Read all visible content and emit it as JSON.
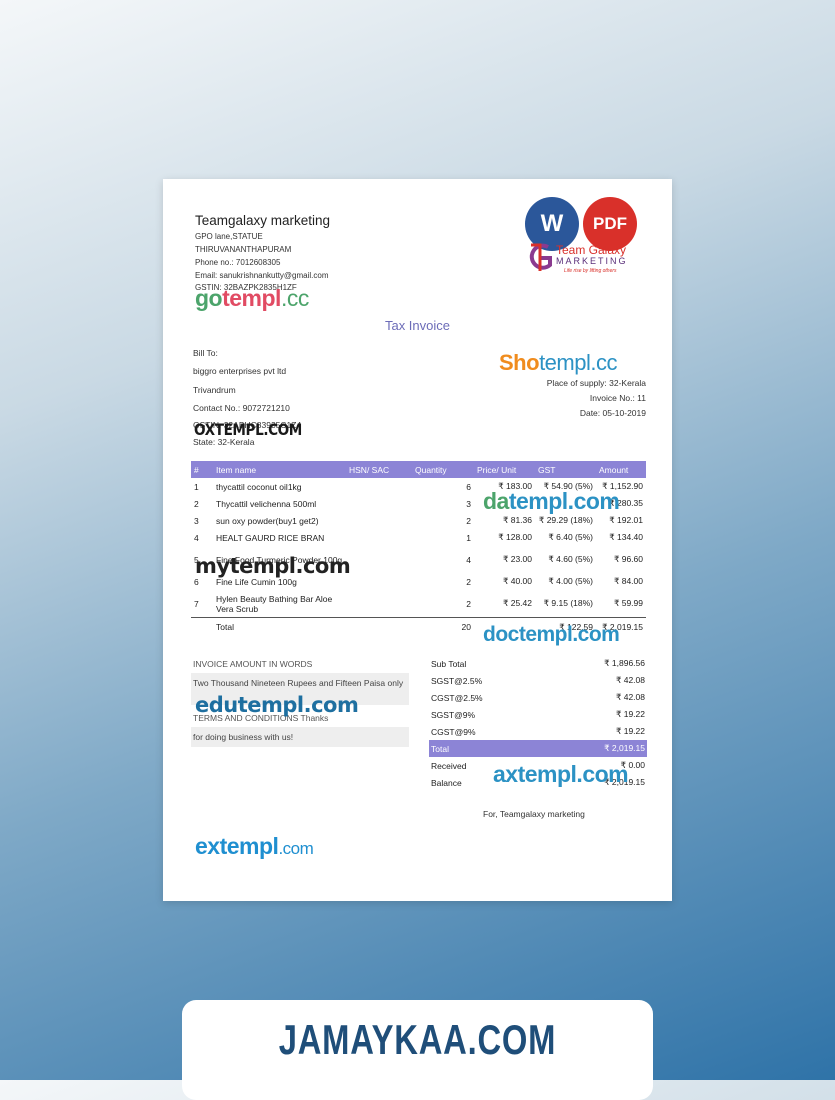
{
  "company": {
    "name": "Teamgalaxy marketing",
    "lines": [
      "GPO lane,STATUE",
      "THIRUVANANTHAPURAM",
      "Phone no.: 7012608305",
      "Email: sanukrishnankutty@gmail.com",
      "GSTIN: 32BAZPK2835H1ZF"
    ]
  },
  "badges": {
    "word": "W",
    "pdf": "PDF"
  },
  "logo": {
    "line1": "Team Galaxy",
    "line2": "MARKETING",
    "tagline": "Life rise by lifting others"
  },
  "doc_title": "Tax Invoice",
  "bill_to": {
    "label": "Bill To:",
    "name": "biggro enterprises pvt ltd",
    "city": "Trivandrum",
    "contact": "Contact No.: 9072721210",
    "gstin": "GSTIN: 32ABHC83935C1Z4",
    "state": "State: 32-Kerala"
  },
  "meta": {
    "place": "Place of supply: 32-Kerala",
    "invoice_no": "Invoice No.: 11",
    "date": "Date: 05-10-2019"
  },
  "table": {
    "headers": [
      "#",
      "Item name",
      "HSN/ SAC",
      "Quantity",
      "Price/ Unit",
      "GST",
      "Amount"
    ],
    "rows": [
      {
        "n": "1",
        "item": "thycattil coconut oil1kg",
        "hsn": "",
        "qty": "6",
        "price": "₹ 183.00",
        "gst": "₹ 54.90 (5%)",
        "amount": "₹ 1,152.90"
      },
      {
        "n": "2",
        "item": "Thycattil velichenna 500ml",
        "hsn": "",
        "qty": "3",
        "price": "",
        "gst": "",
        "amount": "₹ 280.35"
      },
      {
        "n": "3",
        "item": "sun oxy powder(buy1 get2)",
        "hsn": "",
        "qty": "2",
        "price": "₹ 81.36",
        "gst": "₹ 29.29 (18%)",
        "amount": "₹ 192.01"
      },
      {
        "n": "4",
        "item": "HEALT GAURD RICE BRAN",
        "hsn": "",
        "qty": "1",
        "price": "₹ 128.00",
        "gst": "₹ 6.40 (5%)",
        "amount": "₹ 134.40"
      },
      {
        "n": "5",
        "item": "Fine Food Turmeric Powder 100g",
        "hsn": "",
        "qty": "4",
        "price": "₹ 23.00",
        "gst": "₹ 4.60 (5%)",
        "amount": "₹ 96.60"
      },
      {
        "n": "6",
        "item": "Fine Life Cumin 100g",
        "hsn": "",
        "qty": "2",
        "price": "₹ 40.00",
        "gst": "₹ 4.00 (5%)",
        "amount": "₹ 84.00"
      },
      {
        "n": "7",
        "item": "Hylen Beauty Bathing Bar Aloe Vera Scrub",
        "hsn": "",
        "qty": "2",
        "price": "₹ 25.42",
        "gst": "₹ 9.15 (18%)",
        "amount": "₹ 59.99"
      }
    ],
    "total": {
      "label": "Total",
      "qty": "20",
      "gst": "₹ 122.59",
      "amount": "₹ 2,019.15"
    }
  },
  "words": {
    "heading": "INVOICE AMOUNT IN WORDS",
    "text": "Two Thousand Nineteen Rupees and Fifteen Paisa only",
    "terms_heading": "TERMS AND CONDITIONS",
    "terms_inline": "Thanks",
    "terms_text": "for doing business with us!"
  },
  "totals": [
    {
      "label": "Sub Total",
      "value": "₹ 1,896.56"
    },
    {
      "label": "SGST@2.5%",
      "value": "₹ 42.08"
    },
    {
      "label": "CGST@2.5%",
      "value": "₹ 42.08"
    },
    {
      "label": "SGST@9%",
      "value": "₹ 19.22"
    },
    {
      "label": "CGST@9%",
      "value": "₹ 19.22"
    },
    {
      "label": "Total",
      "value": "₹ 2,019.15"
    },
    {
      "label": "Received",
      "value": "₹ 0.00"
    },
    {
      "label": "Balance",
      "value": "₹ 2,019.15"
    }
  ],
  "for_line": "For, Teamgalaxy marketing",
  "watermarks": {
    "gotempl_a": "go",
    "gotempl_b": "templ",
    "gotempl_c": ".cc",
    "shotempl_a": "Sho",
    "shotempl_b": "templ.cc",
    "oxtempl": "OXTEMPL.COM",
    "datempl": "datempl.com",
    "mytempl": "mytempl.com",
    "doctempl": "doctempl.com",
    "edutempl": "edutempl.com",
    "axtempl": "axtempl.com",
    "extempl_a": "extempl",
    "extempl_b": ".com"
  },
  "footer": "JAMAYKAA.COM",
  "colors": {
    "accent": "#8c84d6",
    "title": "#6c6cb8",
    "footer": "#1f4e79"
  }
}
